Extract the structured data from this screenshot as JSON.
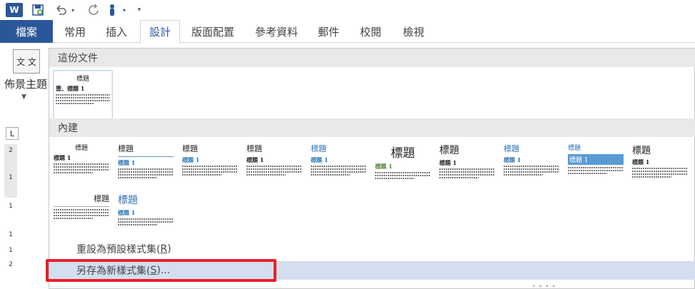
{
  "qat": {
    "app_logo": "W",
    "icons": [
      "word-logo",
      "save-icon",
      "undo-icon",
      "redo-icon",
      "touch-mode-icon",
      "customize-icon"
    ]
  },
  "tabs": [
    {
      "label": "檔案",
      "kind": "file"
    },
    {
      "label": "常用"
    },
    {
      "label": "插入"
    },
    {
      "label": "設計",
      "active": true
    },
    {
      "label": "版面配置"
    },
    {
      "label": "參考資料"
    },
    {
      "label": "郵件"
    },
    {
      "label": "校閱"
    },
    {
      "label": "檢視"
    }
  ],
  "themes_button": {
    "icon_text": "文 文",
    "label": "佈景主題"
  },
  "ruler": {
    "corner": "L",
    "marks": [
      "2",
      "1",
      "1",
      "1",
      "1",
      "2"
    ]
  },
  "gallery": {
    "this_document_header": "這份文件",
    "built_in_header": "內建",
    "this_document_thumb": {
      "title": "標題",
      "heading": "壹、標題 1"
    },
    "thumbs_row1": [
      {
        "title": "標題",
        "heading": "標題 1",
        "style": "center"
      },
      {
        "title": "標題",
        "heading": "標題 1",
        "style": "rule"
      },
      {
        "title": "標題",
        "heading": "標題 1",
        "style": "plain-blue"
      },
      {
        "title": "標題",
        "heading": "標題 1",
        "style": "plain"
      },
      {
        "title": "標題",
        "heading": "標題 1",
        "style": "blue-title"
      },
      {
        "title": "標題",
        "heading": "標題 1",
        "style": "big"
      },
      {
        "title": "標題",
        "heading": "標題 1",
        "style": "serif"
      },
      {
        "title": "標題",
        "heading": "標題 1",
        "style": "blue-both"
      },
      {
        "title": "標題",
        "heading": "標題 1",
        "style": "bar"
      },
      {
        "title": "標題",
        "heading": "標題 1",
        "style": "plain2"
      }
    ],
    "thumbs_row2": [
      {
        "title": "標題",
        "heading": "標題 1",
        "style": "right"
      },
      {
        "title": "標題",
        "heading": "標題 1",
        "style": "large-blue"
      }
    ],
    "reset_label": "重設為預設樣式集(",
    "reset_key": "R",
    "reset_suffix": ")",
    "save_label": "另存為新樣式集(",
    "save_key": "S",
    "save_suffix": ")..."
  },
  "colors": {
    "file_tab": "#2b579a",
    "highlight_box": "#e8202a",
    "hover_row": "#d3deef"
  }
}
